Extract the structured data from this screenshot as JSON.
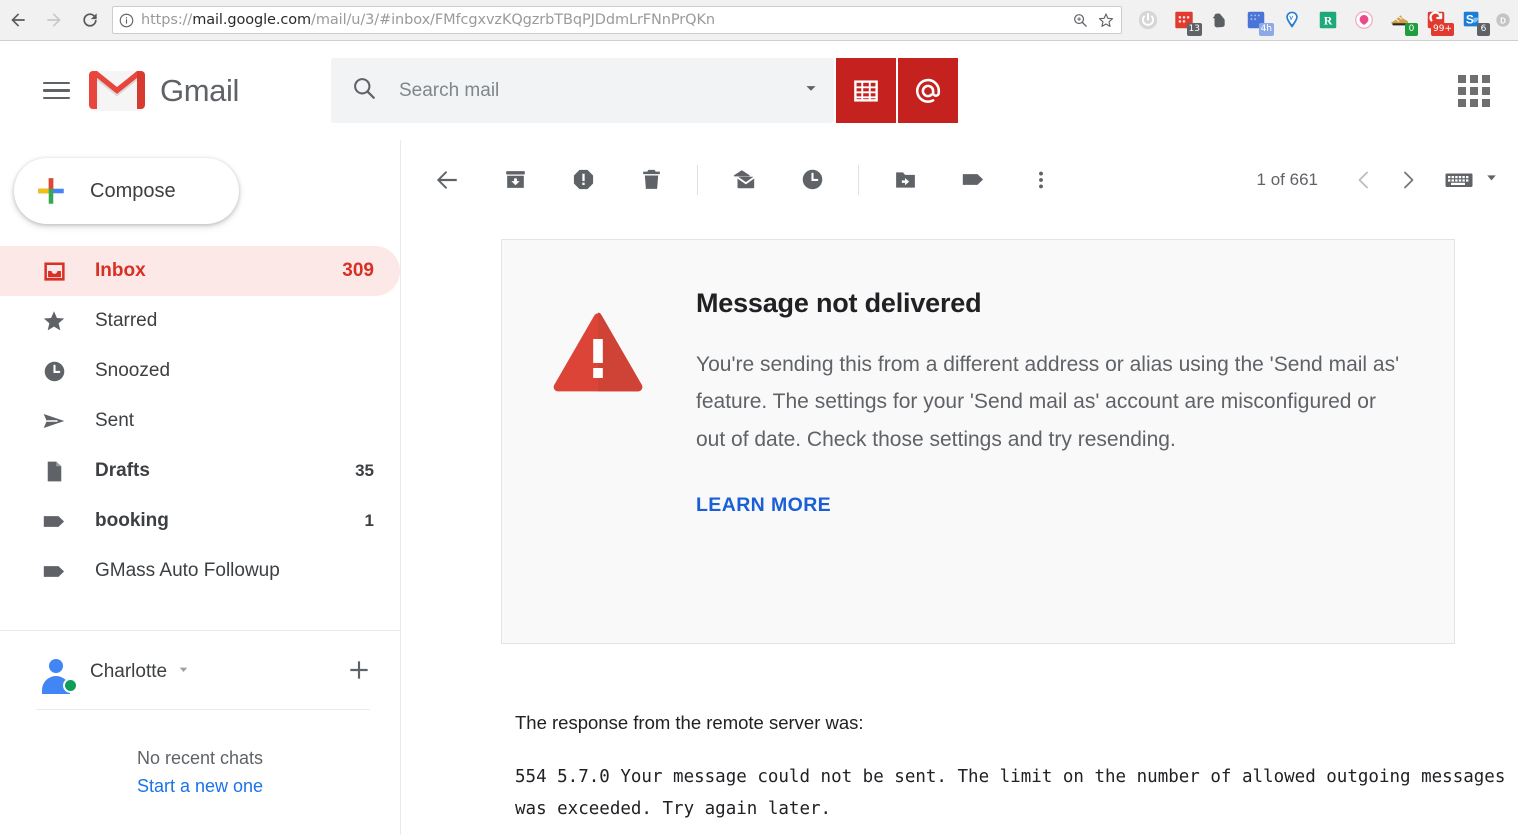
{
  "browser": {
    "back_icon": "back-arrow-icon",
    "forward_icon": "forward-arrow-icon",
    "reload_icon": "reload-icon",
    "site_info_icon": "info-circle-icon",
    "url_scheme": "https://",
    "url_host": "mail.google.com",
    "url_path": "/mail/u/3/#inbox/FMfcgxvzKQgzrbTBqPJDdmLrFNnPrQKn",
    "url_full": "https://mail.google.com/mail/u/3/#inbox/FMfcgxvzKQgzrbTBqPJDdmLrFNnPrQKn",
    "zoom_icon": "zoom-search-icon",
    "bookmark_icon": "star-icon",
    "extensions": [
      {
        "name": "power-toggle-extension",
        "glyph": "⏻",
        "color": "#9aa0a6",
        "badge": "",
        "badge_color": ""
      },
      {
        "name": "calendar-extension",
        "glyph": "",
        "color": "#d93025",
        "badge": "13",
        "badge_color": "#5f6368"
      },
      {
        "name": "evernote-extension",
        "glyph": "",
        "color": "#4f5355",
        "badge": "",
        "badge_color": ""
      },
      {
        "name": "rescuetime-extension",
        "glyph": "",
        "color": "#4a74d6",
        "badge": "4h",
        "badge_color": "#8ea9e8"
      },
      {
        "name": "yandex-extension",
        "glyph": "",
        "color": "#2a7fd4",
        "badge": "",
        "badge_color": ""
      },
      {
        "name": "grammarly-extension",
        "glyph": "R",
        "color": "#1ea97c",
        "badge": "",
        "badge_color": ""
      },
      {
        "name": "ring-extension",
        "glyph": "",
        "color": "#e8467c",
        "badge": "",
        "badge_color": ""
      },
      {
        "name": "shoe-tracker-extension",
        "glyph": "",
        "color": "#c98b2e",
        "badge": "0",
        "badge_color": "#1e9e3f"
      },
      {
        "name": "clipboard-extension",
        "glyph": "C",
        "color": "#d93025",
        "badge": "99+",
        "badge_color": "#d93025"
      },
      {
        "name": "skype-extension",
        "glyph": "S",
        "color": "#1a7fd4",
        "badge": "6",
        "badge_color": "#5f6368"
      },
      {
        "name": "partial-extension",
        "glyph": "D",
        "color": "#bdbdbd",
        "badge": "",
        "badge_color": ""
      }
    ]
  },
  "header": {
    "menu_icon": "hamburger-menu-icon",
    "logo_icon": "gmail-logo-icon",
    "brand": "Gmail",
    "search": {
      "icon": "search-icon",
      "placeholder": "Search mail",
      "value": "",
      "options_icon": "chevron-down-icon"
    },
    "gmass_spreadsheet_icon": "spreadsheet-icon",
    "gmass_at_icon": "at-sign-icon",
    "gmass_button_color": "#c5221f",
    "apps_icon": "apps-grid-icon"
  },
  "sidebar": {
    "compose": {
      "label": "Compose",
      "icon": "plus-icon"
    },
    "items": [
      {
        "label": "Inbox",
        "count": "309",
        "icon": "inbox-icon",
        "active": true,
        "bold": true
      },
      {
        "label": "Starred",
        "count": "",
        "icon": "star-icon",
        "active": false,
        "bold": false
      },
      {
        "label": "Snoozed",
        "count": "",
        "icon": "clock-icon",
        "active": false,
        "bold": false
      },
      {
        "label": "Sent",
        "count": "",
        "icon": "send-icon",
        "active": false,
        "bold": false
      },
      {
        "label": "Drafts",
        "count": "35",
        "icon": "draft-document-icon",
        "active": false,
        "bold": true
      },
      {
        "label": "booking",
        "count": "1",
        "icon": "label-tag-icon",
        "active": false,
        "bold": true
      },
      {
        "label": "GMass Auto Followup",
        "count": "",
        "icon": "label-tag-icon",
        "active": false,
        "bold": false
      }
    ],
    "active_color": "#d93025",
    "active_bg": "#fce8e6",
    "chat": {
      "avatar_icon": "avatar-icon",
      "status_icon": "online-status-dot",
      "name": "Charlotte",
      "caret_icon": "chevron-down-icon",
      "add_icon": "plus-icon",
      "empty_text": "No recent chats",
      "start_link": "Start a new one"
    }
  },
  "toolbar": {
    "buttons": [
      {
        "name": "back-to-inbox-button",
        "icon": "back-arrow-icon"
      },
      {
        "name": "archive-button",
        "icon": "archive-icon"
      },
      {
        "name": "report-spam-button",
        "icon": "spam-exclamation-icon"
      },
      {
        "name": "delete-button",
        "icon": "trash-icon"
      },
      {
        "name": "mark-unread-button",
        "icon": "envelope-icon"
      },
      {
        "name": "snooze-button",
        "icon": "clock-icon"
      },
      {
        "name": "move-to-button",
        "icon": "move-to-folder-icon"
      },
      {
        "name": "labels-button",
        "icon": "label-tag-icon"
      },
      {
        "name": "more-options-button",
        "icon": "kebab-menu-icon"
      }
    ],
    "pagination": {
      "current": "1",
      "separator": " of ",
      "total": "661",
      "text": "1 of 661"
    },
    "prev_icon": "chevron-left-icon",
    "next_icon": "chevron-right-icon",
    "keyboard_icon": "keyboard-icon",
    "keyboard_caret_icon": "chevron-down-icon"
  },
  "message": {
    "error_icon": "warning-triangle-icon",
    "error_color": "#db4437",
    "title": "Message not delivered",
    "body": "You're sending this from a different address or alias using the 'Send mail as' feature. The settings for your 'Send mail as' account are misconfigured or out of date. Check those settings and try resending.",
    "learn_more": "LEARN MORE",
    "learn_more_color": "#1a5fd6",
    "server_lead": "The response from the remote server was:",
    "server_response": "554 5.7.0 Your message could not be sent. The limit on the number of allowed outgoing messages was exceeded. Try again later."
  }
}
